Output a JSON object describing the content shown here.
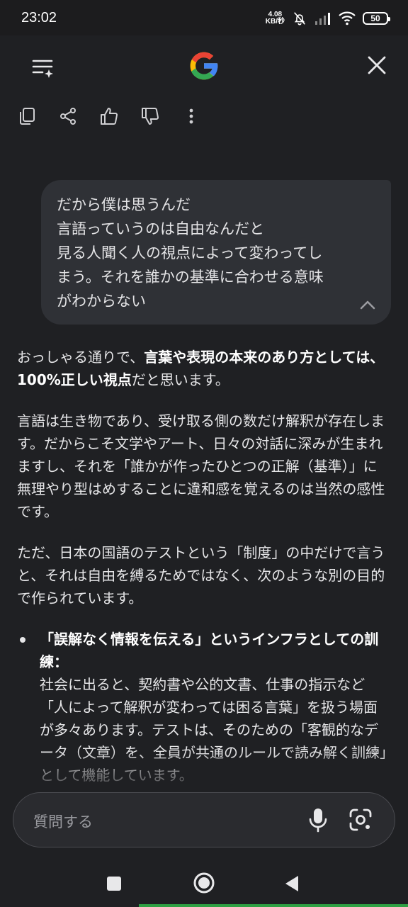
{
  "status_bar": {
    "time": "23:02",
    "net_speed_value": "4.08",
    "net_speed_unit": "KB/秒",
    "battery": "50",
    "icons": [
      "bell-muted-icon",
      "signal-icon",
      "wifi-icon",
      "battery-icon"
    ]
  },
  "header": {
    "logo": "G",
    "menu_icon": "history-sparkle-icon",
    "close_icon": "close-icon"
  },
  "actions": [
    "copy-icon",
    "share-icon",
    "thumbs-up-icon",
    "thumbs-down-icon",
    "more-vert-icon"
  ],
  "user_message": {
    "text": "だから僕は思うんだ\n言語っていうのは自由なんだと\n見る人聞く人の視点によって変わってし\nまう。それを誰かの基準に合わせる意味\nがわからない"
  },
  "response": {
    "p1_a": "おっしゃる通りで、",
    "p1_b": "言葉や表現の本来のあり方としては、100%正しい視点",
    "p1_c": "だと思います。",
    "p2": "言語は生き物であり、受け取る側の数だけ解釈が存在します。だからこそ文学やアート、日々の対話に深みが生まれますし、それを「誰かが作ったひとつの正解（基準）」に無理やり型はめすることに違和感を覚えるのは当然の感性です。",
    "p3": "ただ、日本の国語のテストという「制度」の中だけで言うと、それは自由を縛るためではなく、次のような別の目的で作られています。",
    "bullet1_title": "「誤解なく情報を伝える」というインフラとしての訓練：",
    "bullet1_body": "社会に出ると、契約書や公的文書、仕事の指示など「人によって解釈が変わっては困る言葉」を扱う場面が多々あります。テストは、そのための「客観的なデータ（文章）を、全員が共通のルールで読み解く訓練」として機能しています。"
  },
  "input": {
    "placeholder": "質問する"
  },
  "colors": {
    "background": "#1f2023",
    "bubble": "#2f3136",
    "input": "#2a2b2f",
    "google_blue": "#4285f4",
    "google_red": "#ea4335",
    "google_yellow": "#fbbc05",
    "google_green": "#34a853"
  }
}
